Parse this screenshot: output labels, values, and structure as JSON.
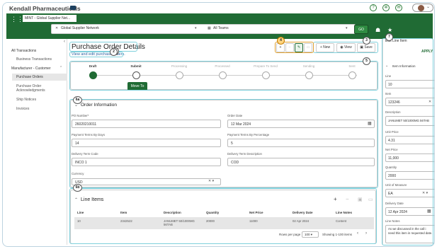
{
  "app": {
    "title": "Kendall Pharmaceuticals"
  },
  "tabs": [
    {
      "label": "MINT - Global Supplier Net..."
    }
  ],
  "filters": {
    "network": "Global Supplier Network",
    "teams": "All Teams",
    "go": "GO"
  },
  "sidebar": {
    "sections": [
      {
        "title": "All Transactions",
        "items": [
          "Business Transactions"
        ]
      },
      {
        "title": "Manufacturer - Customer",
        "items": [
          "Purchase Orders",
          "Purchase Order Acknowledgments",
          "Ship Notices",
          "Invoices"
        ]
      }
    ],
    "selected": "Purchase Orders"
  },
  "page": {
    "title": "Purchase Order Details",
    "subtitle": "View and edit purchase orders."
  },
  "toolbar": {
    "new": "New",
    "view": "View",
    "save": "Save"
  },
  "steps": [
    "Draft",
    "Submit",
    "Processing",
    "Processed",
    "Prepare To Send",
    "Sending",
    "Sent"
  ],
  "move_to": "Move To",
  "order_info": {
    "title": "Order Information",
    "fields": [
      {
        "label": "PO Number*",
        "value": "26020210011"
      },
      {
        "label": "Order Date",
        "value": "12 Mar 2024"
      },
      {
        "label": "Payment Terms By Days",
        "value": "14"
      },
      {
        "label": "Payment Terms By Percentage",
        "value": "5"
      },
      {
        "label": "Delivery Term Code",
        "value": "INCO 1"
      },
      {
        "label": "Delivery Term Description",
        "value": "COD"
      },
      {
        "label": "Currency",
        "value": "USD"
      }
    ]
  },
  "line_items": {
    "title": "Line Items",
    "columns": [
      "Line",
      "Item",
      "Description",
      "Quantity",
      "Net Price",
      "Delivery Date",
      "Line Notes"
    ],
    "rows": [
      [
        "10",
        "2342522",
        "JANUMET 50/1000MG 56TAB",
        "20000",
        "11000",
        "02 Apr 2024",
        "Content"
      ]
    ],
    "rows_per_page_label": "Rows per page",
    "rows_per_page": "100",
    "showing": "Showing 1-100 items"
  },
  "edit_panel": {
    "title": "Edit Line Item",
    "apply": "APPLY",
    "section": "Item Information",
    "fields": [
      {
        "label": "Line",
        "value": "10"
      },
      {
        "label": "Item",
        "value": "123246"
      },
      {
        "label": "Description",
        "value": "JANUMET 50/1000MG 56TAB"
      },
      {
        "label": "Unit Price",
        "value": "4.31"
      },
      {
        "label": "Net Price",
        "value": "11,000"
      },
      {
        "label": "Quantity",
        "value": "2000"
      },
      {
        "label": "Unit of Measure",
        "value": "EA"
      },
      {
        "label": "Delivery Date",
        "value": "12 Apr 2024"
      },
      {
        "label": "Line Notes",
        "value": "As we discussed in the call i need this item in requested date."
      }
    ]
  },
  "annotations": [
    "1",
    "2",
    "3",
    "4",
    "5",
    "6a",
    "6b",
    "7"
  ],
  "colors": {
    "brand_green": "#206b34",
    "annotation": "#7fd0dc",
    "link": "#2a62a0"
  }
}
